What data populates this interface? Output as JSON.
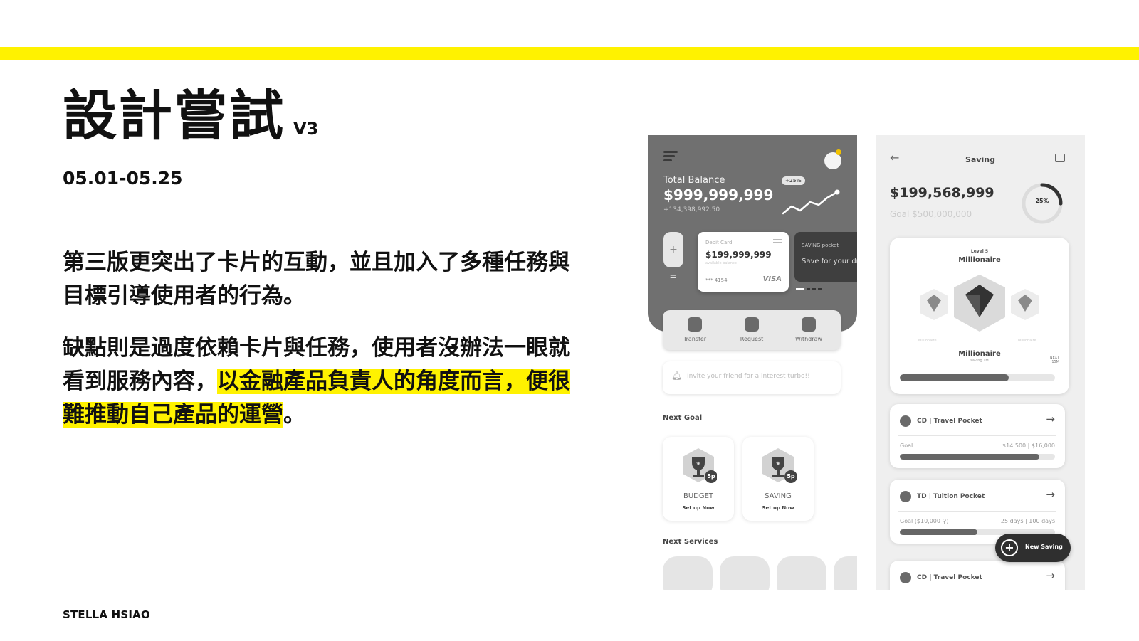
{
  "slide": {
    "title": "設計嘗試",
    "version": "V3",
    "dates": "05.01-05.25",
    "paragraph1": "第三版更突出了卡片的互動，並且加入了多種任務與目標引導使用者的行為。",
    "paragraph2_plain": "缺點則是過度依賴卡片與任務，使用者沒辦法一眼就看到服務內容，",
    "paragraph2_highlight": "以金融產品負責人的角度而言，便很難推動自己產品的運營",
    "paragraph2_end": "。",
    "footer": "STELLA HSIAO",
    "accent_color": "#FFF200"
  },
  "home_screen": {
    "total_balance_label": "Total Balance",
    "total_balance_value": "$999,999,999",
    "balance_change": "+134,398,992.50",
    "change_badge": "+25%",
    "side_add": "+",
    "debit_card": {
      "label": "Debit Card",
      "amount": "$199,999,999",
      "available": "available balance",
      "number": "*** 4154",
      "brand": "VISA"
    },
    "saving_card": {
      "label": "SAVING pocket",
      "text": "Save for your dream"
    },
    "actions": [
      {
        "label": "Transfer",
        "icon": "transfer-icon"
      },
      {
        "label": "Request",
        "icon": "request-icon"
      },
      {
        "label": "Withdraw",
        "icon": "withdraw-icon"
      }
    ],
    "invite_text": "Invite your friend for a interest turbo!!",
    "next_goal_title": "Next Goal",
    "goals": [
      {
        "name": "BUDGET",
        "sub": "Set up Now",
        "points": "5p"
      },
      {
        "name": "SAVING",
        "sub": "Set up Now",
        "points": "5p"
      }
    ],
    "next_services_title": "Next Services"
  },
  "saving_screen": {
    "title": "Saving",
    "amount": "$199,568,999",
    "goal": "Goal  $500,000,000",
    "progress_label": "25%",
    "progress_value": 0.25,
    "level_small": "Level 5",
    "level_name": "Millionaire",
    "side_left": "Millionaire",
    "side_right": "Millionaire",
    "level_name_2": "Millionaire",
    "level_sub": "saving 1M",
    "next_label": "NEXT",
    "next_value": "15M",
    "level_progress": 0.7,
    "pockets": [
      {
        "name": "CD | Travel Pocket",
        "goal_left": "Goal",
        "goal_right": "$14,500  |  $16,000",
        "progress": 0.9
      },
      {
        "name": "TD | Tuition Pocket",
        "goal_left": "Goal ($10,000 ⚲)",
        "goal_right": "25 days  |  100 days",
        "progress": 0.5
      },
      {
        "name": "CD | Travel Pocket",
        "goal_left": "",
        "goal_right": "",
        "progress": 0
      }
    ],
    "fab_label": "New Saving"
  }
}
